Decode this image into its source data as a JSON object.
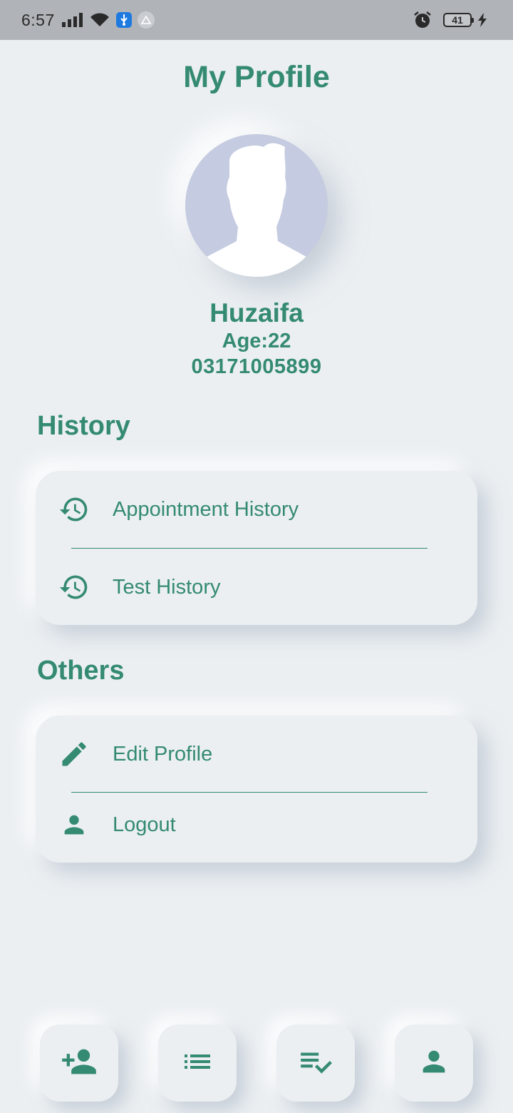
{
  "status_bar": {
    "time": "6:57",
    "battery": "41",
    "icons": [
      "signal-icon",
      "wifi-icon",
      "usb-icon",
      "drive-icon",
      "alarm-icon",
      "battery-icon",
      "charging-icon"
    ]
  },
  "header": {
    "title": "My Profile"
  },
  "profile": {
    "name": "Huzaifa",
    "age": "Age:22",
    "phone": "03171005899"
  },
  "history": {
    "title": "History",
    "items": [
      {
        "label": "Appointment History",
        "icon": "history-icon"
      },
      {
        "label": "Test History",
        "icon": "history-icon"
      }
    ]
  },
  "others": {
    "title": "Others",
    "items": [
      {
        "label": "Edit Profile",
        "icon": "pencil-icon"
      },
      {
        "label": "Logout",
        "icon": "person-icon"
      }
    ]
  },
  "bottom_nav": [
    "add-person-icon",
    "list-icon",
    "checklist-icon",
    "person-icon"
  ],
  "colors": {
    "accent": "#348a72",
    "background": "#ebeff2",
    "avatar_bg": "#c5cbe0"
  }
}
